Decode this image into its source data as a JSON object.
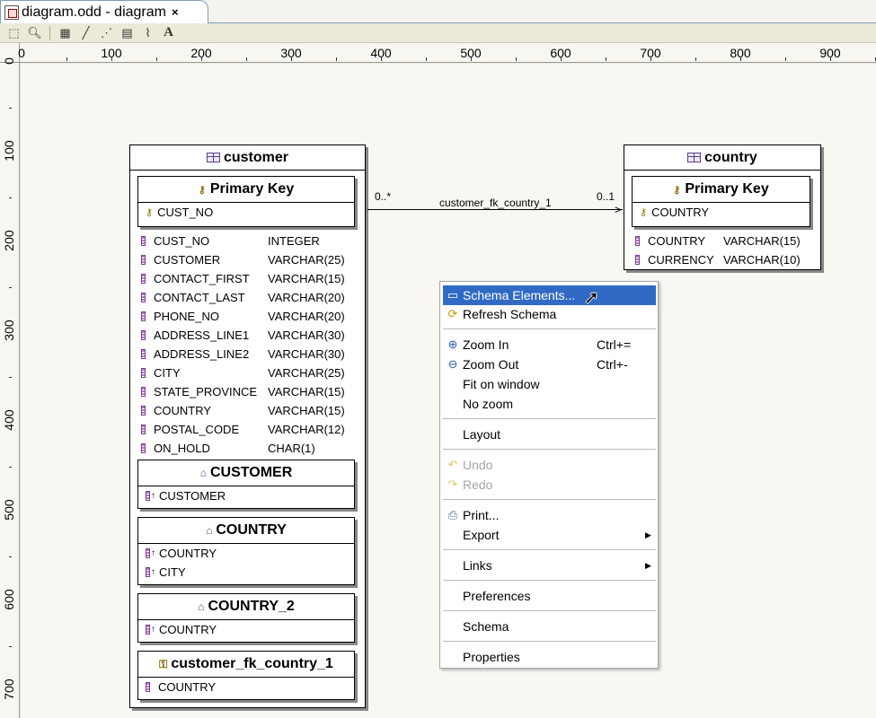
{
  "tab": {
    "title": "diagram.odd - diagram",
    "close": "×"
  },
  "toolbar": {
    "tools": [
      "select-icon",
      "zoom-icon",
      "table-icon",
      "line-icon",
      "dashed-line-icon",
      "note-icon",
      "attach-icon",
      "text-icon"
    ]
  },
  "ruler": {
    "h_labels": [
      "0",
      "100",
      "200",
      "300",
      "400",
      "500",
      "600",
      "700",
      "800",
      "900"
    ],
    "v_labels": [
      "0",
      "100",
      "200",
      "300",
      "400",
      "500",
      "600",
      "700"
    ]
  },
  "customer": {
    "title": "customer",
    "pk": {
      "title": "Primary Key",
      "items": [
        "CUST_NO"
      ]
    },
    "columns": [
      {
        "name": "CUST_NO",
        "type": "INTEGER"
      },
      {
        "name": "CUSTOMER",
        "type": "VARCHAR(25)"
      },
      {
        "name": "CONTACT_FIRST",
        "type": "VARCHAR(15)"
      },
      {
        "name": "CONTACT_LAST",
        "type": "VARCHAR(20)"
      },
      {
        "name": "PHONE_NO",
        "type": "VARCHAR(20)"
      },
      {
        "name": "ADDRESS_LINE1",
        "type": "VARCHAR(30)"
      },
      {
        "name": "ADDRESS_LINE2",
        "type": "VARCHAR(30)"
      },
      {
        "name": "CITY",
        "type": "VARCHAR(25)"
      },
      {
        "name": "STATE_PROVINCE",
        "type": "VARCHAR(15)"
      },
      {
        "name": "COUNTRY",
        "type": "VARCHAR(15)"
      },
      {
        "name": "POSTAL_CODE",
        "type": "VARCHAR(12)"
      },
      {
        "name": "ON_HOLD",
        "type": "CHAR(1)"
      }
    ],
    "indexes": [
      {
        "title": "CUSTOMER",
        "items": [
          "CUSTOMER"
        ]
      },
      {
        "title": "COUNTRY",
        "items": [
          "COUNTRY",
          "CITY"
        ]
      },
      {
        "title": "COUNTRY_2",
        "items": [
          "COUNTRY"
        ]
      }
    ],
    "fk": {
      "title": "customer_fk_country_1",
      "items": [
        "COUNTRY"
      ]
    }
  },
  "country": {
    "title": "country",
    "pk": {
      "title": "Primary Key",
      "items": [
        "COUNTRY"
      ]
    },
    "columns": [
      {
        "name": "COUNTRY",
        "type": "VARCHAR(15)"
      },
      {
        "name": "CURRENCY",
        "type": "VARCHAR(10)"
      }
    ]
  },
  "relation": {
    "name": "customer_fk_country_1",
    "from_card": "0..*",
    "to_card": "0..1"
  },
  "menu": {
    "items": [
      {
        "label": "Schema Elements...",
        "icon": "schema-elements-icon",
        "selected": true
      },
      {
        "label": "Refresh Schema",
        "icon": "refresh-icon"
      },
      {
        "label": "Zoom In",
        "icon": "zoom-in-icon",
        "shortcut": "Ctrl+="
      },
      {
        "label": "Zoom Out",
        "icon": "zoom-out-icon",
        "shortcut": "Ctrl+-"
      },
      {
        "label": "Fit on window"
      },
      {
        "label": "No zoom"
      },
      {
        "label": "Layout"
      },
      {
        "label": "Undo",
        "icon": "undo-icon",
        "disabled": true
      },
      {
        "label": "Redo",
        "icon": "redo-icon",
        "disabled": true
      },
      {
        "label": "Print...",
        "icon": "print-icon"
      },
      {
        "label": "Export",
        "submenu": true
      },
      {
        "label": "Links",
        "submenu": true
      },
      {
        "label": "Preferences"
      },
      {
        "label": "Schema"
      },
      {
        "label": "Properties"
      }
    ]
  }
}
